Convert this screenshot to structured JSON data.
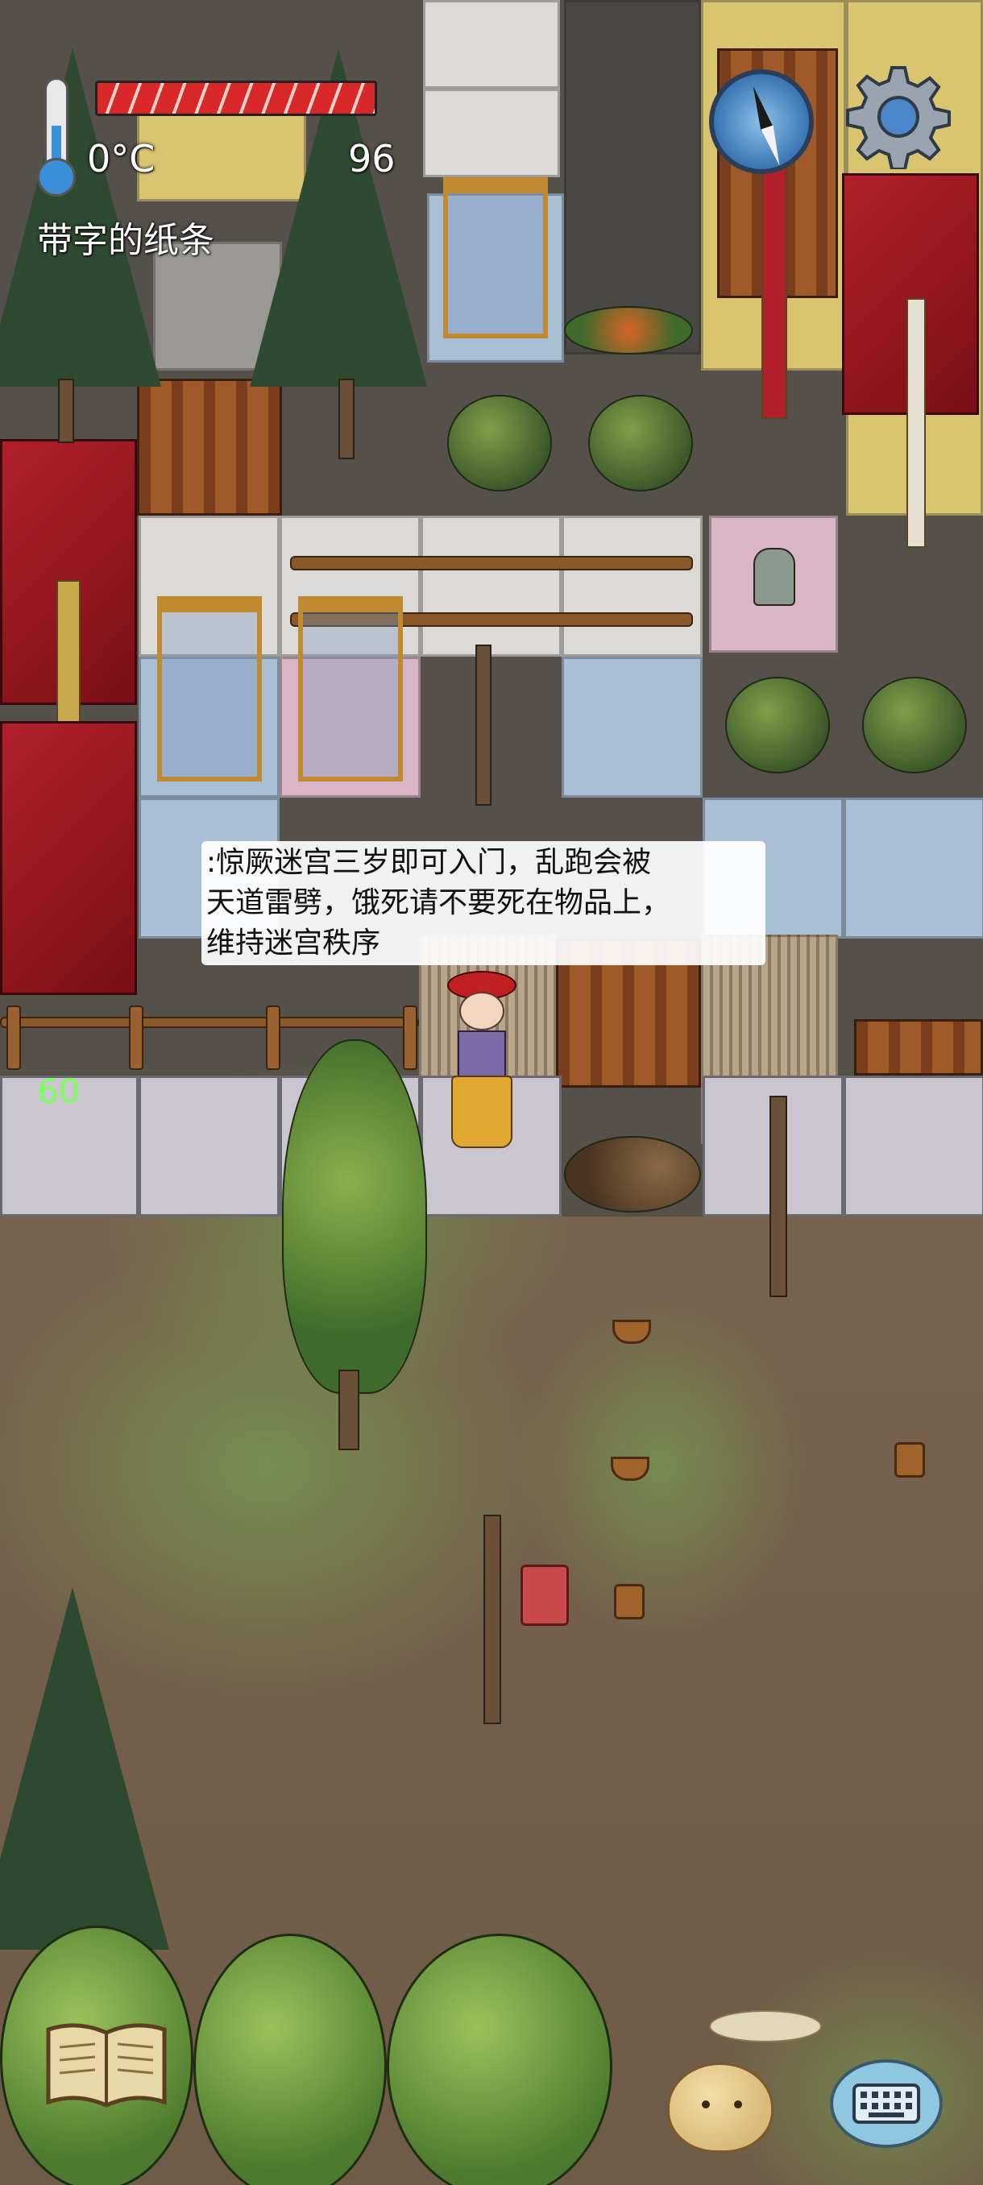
{
  "hud": {
    "temperature": "0°C",
    "food_bar_level_percent": 100,
    "food_value": "96",
    "held_item": "带字的纸条",
    "fps": "60"
  },
  "speech_bubble": {
    "lines": [
      ":惊厥迷宫三岁即可入门，乱跑会被",
      "天道雷劈，饿死请不要死在物品上，",
      "维持迷宫秩序"
    ]
  },
  "icons": {
    "thermometer": "thermometer-icon",
    "compass": "compass-icon",
    "settings": "gear-icon",
    "tech_book": "book-icon",
    "emote": "potato-emote-icon",
    "chat": "keyboard-icon"
  },
  "colors": {
    "food_bar": "#d8282a",
    "fps_text": "#7cff5a",
    "thermometer_fill": "#3a8fd8",
    "compass_face": "#3470b0"
  }
}
